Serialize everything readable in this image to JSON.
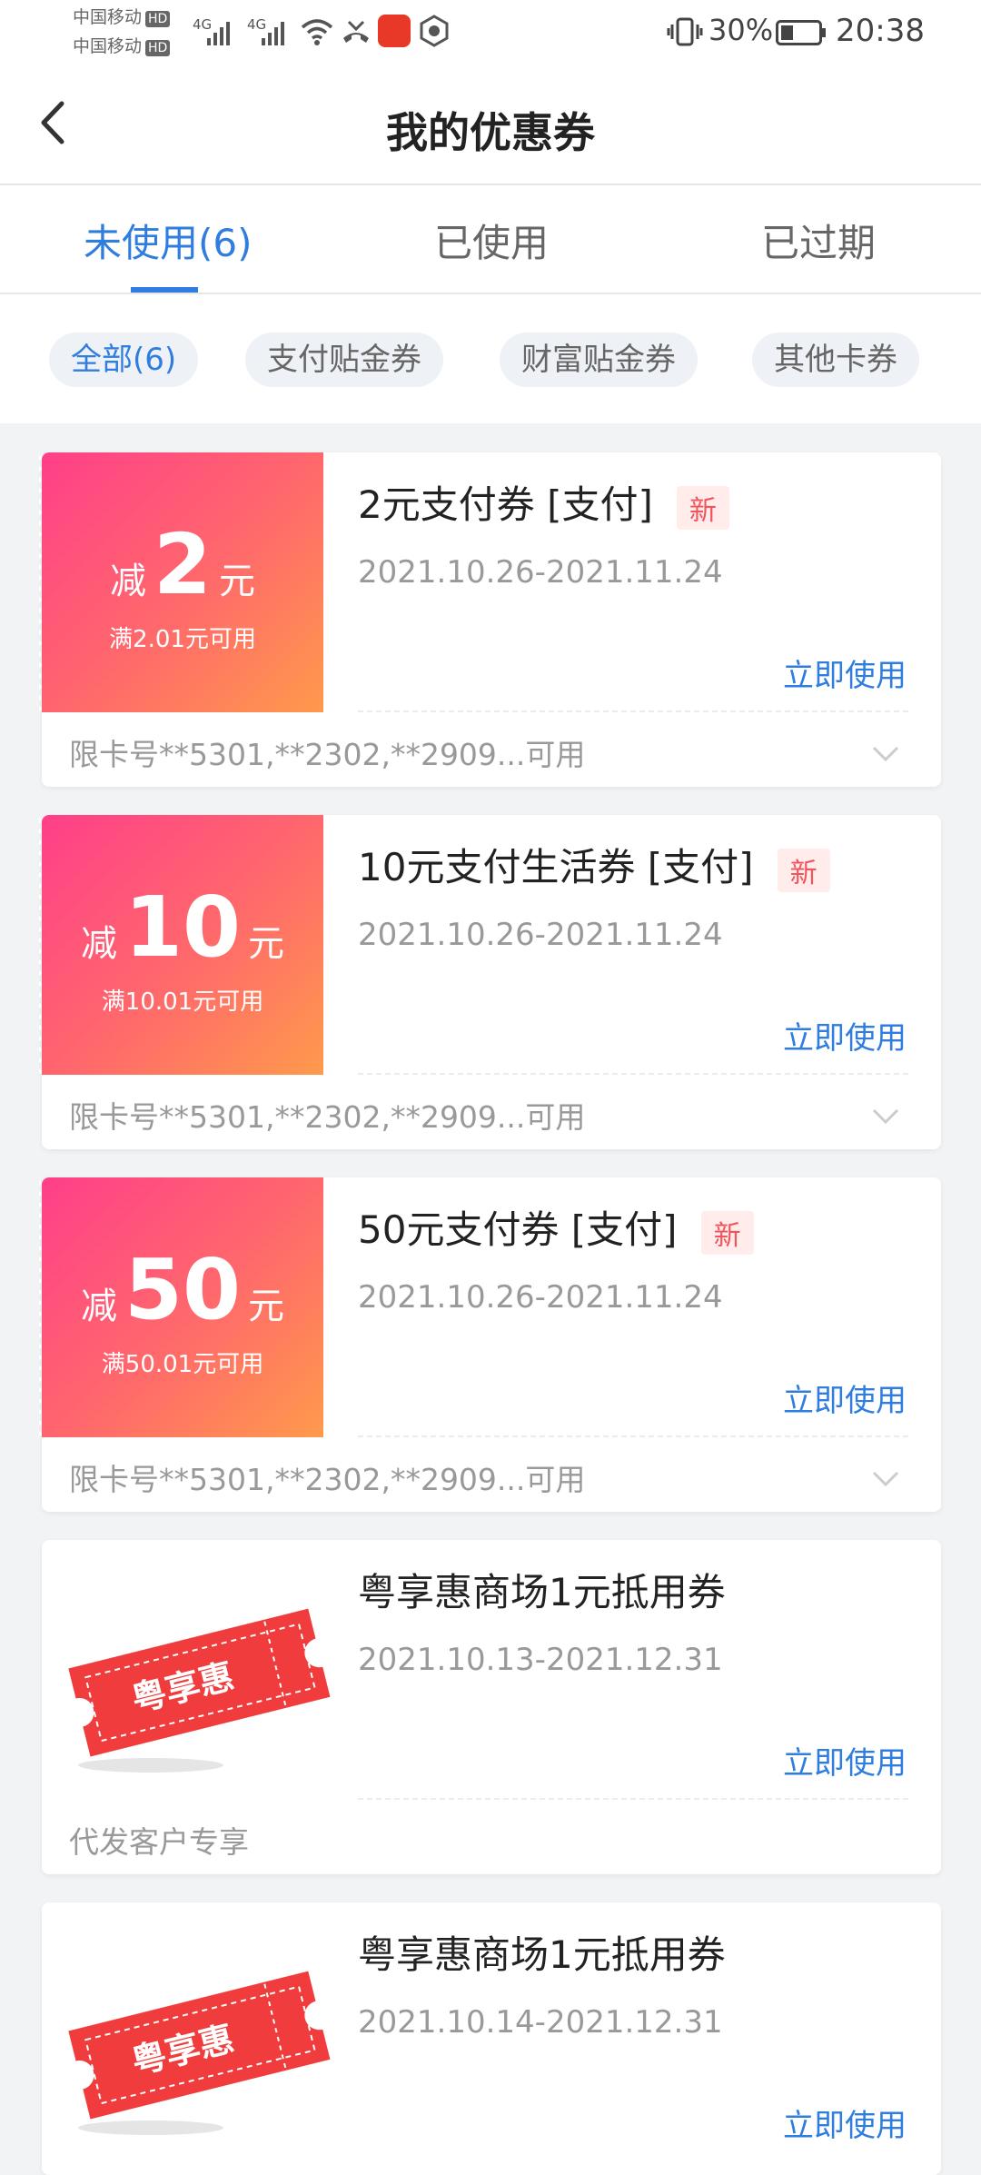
{
  "status_bar": {
    "carrier1": "中国移动",
    "carrier2": "中国移动",
    "hd": "HD",
    "net1": "4G",
    "net2": "4G",
    "battery": "30%",
    "time": "20:38"
  },
  "header": {
    "title": "我的优惠券"
  },
  "tabs": [
    {
      "label": "未使用(6)"
    },
    {
      "label": "已使用"
    },
    {
      "label": "已过期"
    }
  ],
  "filters": [
    {
      "label": "全部(6)"
    },
    {
      "label": "支付贴金券"
    },
    {
      "label": "财富贴金券"
    },
    {
      "label": "其他卡券"
    }
  ],
  "coupons": [
    {
      "prefix": "减",
      "amount": "2",
      "unit": "元",
      "condition": "满2.01元可用",
      "name": "2元支付券  [支付]",
      "badge": "新",
      "date": "2021.10.26-2021.11.24",
      "action": "立即使用",
      "restriction": "限卡号**5301,**2302,**2909...可用"
    },
    {
      "prefix": "减",
      "amount": "10",
      "unit": "元",
      "condition": "满10.01元可用",
      "name": "10元支付生活券  [支付]",
      "badge": "新",
      "date": "2021.10.26-2021.11.24",
      "action": "立即使用",
      "restriction": "限卡号**5301,**2302,**2909...可用"
    },
    {
      "prefix": "减",
      "amount": "50",
      "unit": "元",
      "condition": "满50.01元可用",
      "name": "50元支付券  [支付]",
      "badge": "新",
      "date": "2021.10.26-2021.11.24",
      "action": "立即使用",
      "restriction": "限卡号**5301,**2302,**2909...可用"
    },
    {
      "ticket_text": "粤享惠",
      "name": "粤享惠商场1元抵用券",
      "date": "2021.10.13-2021.12.31",
      "action": "立即使用",
      "restriction": "代发客户专享"
    },
    {
      "ticket_text": "粤享惠",
      "name": "粤享惠商场1元抵用券",
      "date": "2021.10.14-2021.12.31",
      "action": "立即使用"
    }
  ],
  "colors": {
    "accent": "#2f7dde",
    "badge_text": "#f2545b",
    "stub_start": "#ff3f8a",
    "stub_end": "#ff9a4c",
    "ticket": "#f03c3c"
  }
}
